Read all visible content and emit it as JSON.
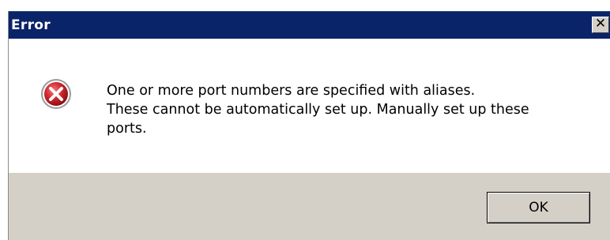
{
  "dialog": {
    "title": "Error",
    "close_label": "✕",
    "icon": "error-icon",
    "message_lines": [
      "One or more port numbers are specified with aliases.",
      "These cannot be automatically set up.  Manually set up these",
      "ports."
    ],
    "ok_label": "OK"
  },
  "colors": {
    "titlebar": "#0a246a",
    "button_face": "#d4d0c8",
    "error_red": "#c1272d"
  }
}
